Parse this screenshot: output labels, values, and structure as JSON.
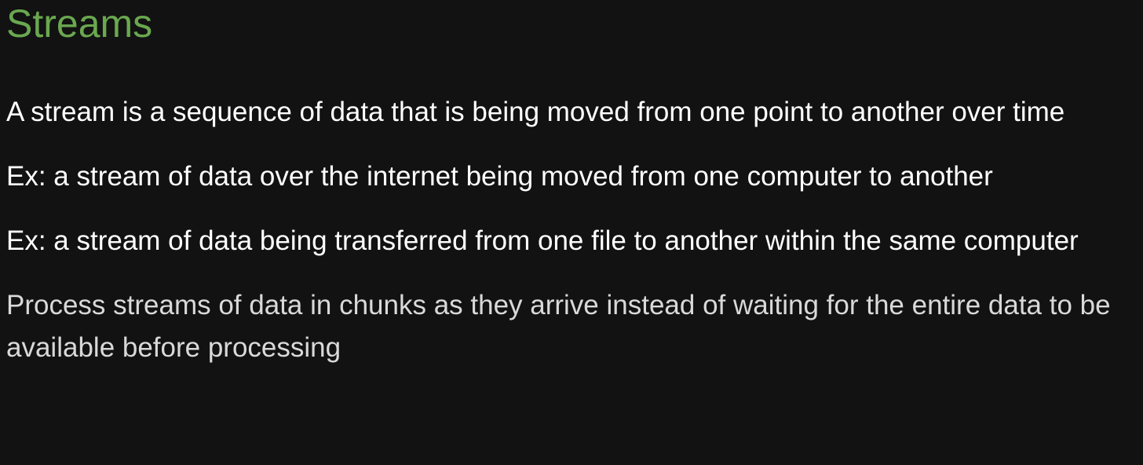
{
  "slide": {
    "title": "Streams",
    "bullets": [
      "A stream is a sequence of data that is being moved from one point to another over time",
      "Ex: a stream of data over the internet being moved from one computer to another",
      "Ex: a stream of data being transferred from one file to another within the same computer",
      "Process streams of data in chunks as they arrive instead of waiting for the entire data to be available before processing"
    ]
  },
  "colors": {
    "background": "#121212",
    "title": "#6aa84f",
    "text": "#ffffff",
    "text_dim": "#d9d9d9"
  }
}
